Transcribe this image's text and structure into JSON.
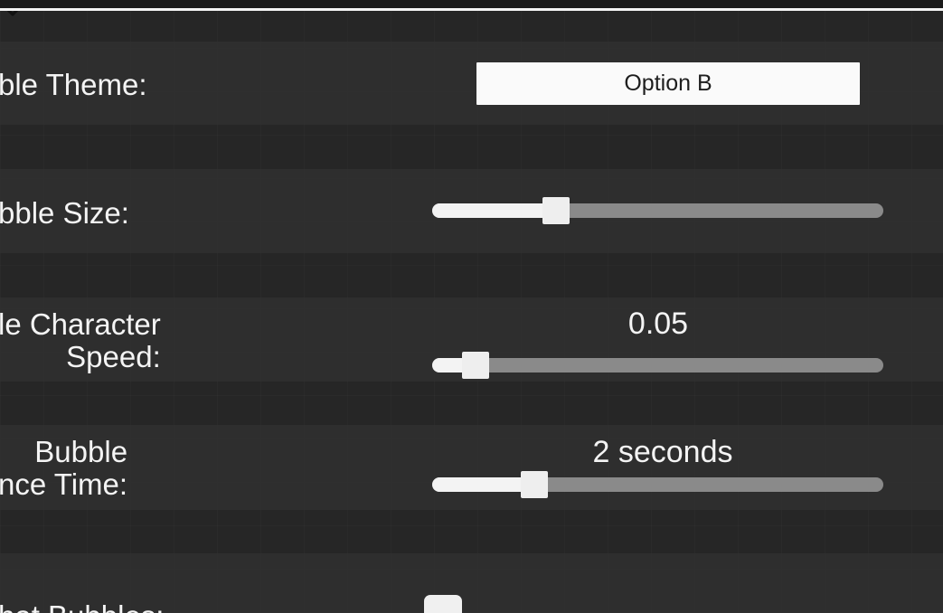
{
  "settings": {
    "theme": {
      "label": "ble Theme:",
      "selected": "Option B"
    },
    "size": {
      "label": "bble Size:",
      "value_fraction": 0.26
    },
    "speed": {
      "label": "le Character\n Speed:",
      "value_text": "0.05",
      "value_fraction": 0.07
    },
    "time": {
      "label": " Bubble\nnce Time:",
      "value_text": "2 seconds",
      "value_fraction": 0.21
    },
    "show": {
      "label": "hat Bubbles:"
    }
  },
  "icons": {
    "dropdown": "chevron-down-icon"
  },
  "colors": {
    "background": "#262626",
    "row_band": "#303030",
    "text": "#f4f4f4",
    "slider_fill": "#f3f3f3",
    "slider_track": "#8a8a8a"
  }
}
